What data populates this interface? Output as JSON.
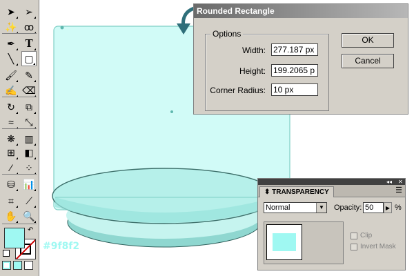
{
  "colors": {
    "fill": "#9ff8f2",
    "stroke": "#000000",
    "artwork_fill": "#d1fbf7",
    "artwork_stroke": "#7fcfc6"
  },
  "toolbox": {
    "tools": [
      [
        "selection-arrow-icon",
        "direct-selection-icon"
      ],
      [
        "magic-wand-icon",
        "lasso-icon"
      ],
      [
        "pen-icon",
        "type-icon"
      ],
      [
        "line-segment-icon",
        "rounded-rectangle-icon"
      ],
      [
        "paintbrush-icon",
        "pencil-icon"
      ],
      [
        "blob-brush-icon",
        "eraser-icon"
      ],
      [
        "rotate-icon",
        "scale-icon"
      ],
      [
        "warp-icon",
        "free-transform-icon"
      ],
      [
        "symbol-sprayer-icon",
        "column-graph-icon"
      ],
      [
        "mesh-icon",
        "gradient-icon"
      ],
      [
        "eyedropper-icon",
        "blend-icon"
      ],
      [
        "live-paint-icon",
        "bar-graph-icon"
      ],
      [
        "artboard-icon",
        "slice-icon"
      ],
      [
        "hand-icon",
        "zoom-icon"
      ]
    ],
    "type_glyph": "T"
  },
  "hex_label": "#9f8f2",
  "dialog": {
    "title": "Rounded Rectangle",
    "group_label": "Options",
    "width_label": "Width:",
    "width_value": "277.187 px",
    "height_label": "Height:",
    "height_value": "199.2065 p",
    "radius_label": "Corner Radius:",
    "radius_value": "10 px",
    "ok_label": "OK",
    "cancel_label": "Cancel"
  },
  "transparency": {
    "tab_label": "TRANSPARENCY",
    "blend_mode": "Normal",
    "opacity_label": "Opacity:",
    "opacity_value": "50",
    "opacity_unit": "%",
    "clip_label": "Clip",
    "invert_mask_label": "Invert Mask"
  }
}
